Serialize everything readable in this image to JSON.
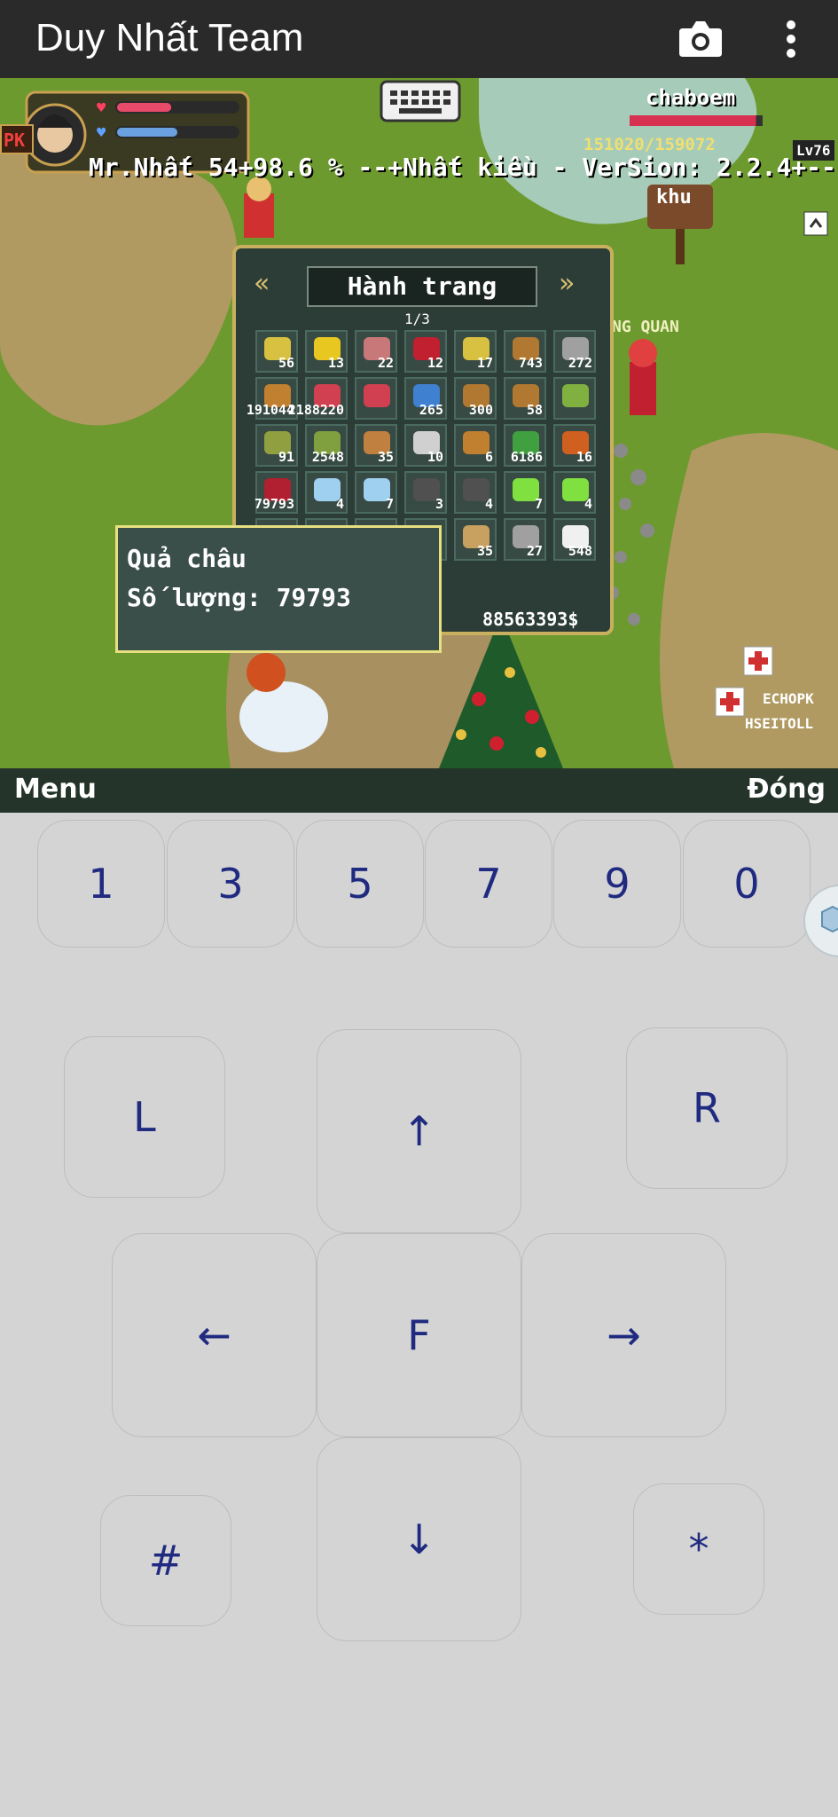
{
  "appbar": {
    "title": "Duy Nhất Team",
    "camera_icon": "camera-icon",
    "more_icon": "more-vert-icon"
  },
  "hud": {
    "pk_badge": "PK",
    "player_info": "Mr.Nhất 54+98.6 % --+Nhất kiều - VerSion: 2.2.4+--",
    "target_name": "chaboem",
    "target_hp": "151020/159072",
    "level": "Lv76",
    "map_sign": "khu",
    "npc_label": "NG QUAN",
    "hp_fill": 0.45,
    "mp_fill": 0.5,
    "target_hp_fill": 0.95,
    "other_names": [
      "ECHOPK",
      "HSEITOLL"
    ]
  },
  "inventory": {
    "title": "Hành trang",
    "page": "1/3",
    "gold": "88563393$",
    "rows": [
      [
        "56",
        "13",
        "22",
        "12",
        "17",
        "743",
        "272"
      ],
      [
        "191044",
        "2188220",
        "",
        "265",
        "300",
        "58",
        ""
      ],
      [
        "91",
        "2548",
        "35",
        "10",
        "6",
        "6186",
        "16"
      ],
      [
        "79793",
        "4",
        "7",
        "3",
        "4",
        "7",
        "4"
      ],
      [
        "",
        "",
        "",
        "",
        "35",
        "27",
        "548"
      ]
    ],
    "item_colors": [
      [
        "#d8c040",
        "#e8c820",
        "#c87878",
        "#c02030",
        "#d8c040",
        "#b07830",
        "#a0a0a0"
      ],
      [
        "#c08030",
        "#d04050",
        "#d04050",
        "#4080d0",
        "#b07830",
        "#b07830",
        "#80b040"
      ],
      [
        "#90a040",
        "#80a040",
        "#c08040",
        "#d0d0d0",
        "#c08030",
        "#40a040",
        "#d06020"
      ],
      [
        "#b02030",
        "#a0d0f0",
        "#a0d0f0",
        "#505050",
        "#505050",
        "#80e040",
        "#80e040"
      ],
      [
        "#384a44",
        "#384a44",
        "#384a44",
        "#384a44",
        "#c8a060",
        "#a0a0a0",
        "#f0f0f0"
      ]
    ]
  },
  "tooltip": {
    "item_name": "Quả châu",
    "quantity_line": "Số lượng: 79793"
  },
  "softkeys": {
    "left": "Menu",
    "right": "Đóng"
  },
  "keypad": {
    "top_row": [
      "1",
      "3",
      "5",
      "7",
      "9",
      "0"
    ],
    "l": "L",
    "r": "R",
    "up": "↑",
    "left": "←",
    "fire": "F",
    "right": "→",
    "hash": "#",
    "down": "↓",
    "star": "*"
  }
}
